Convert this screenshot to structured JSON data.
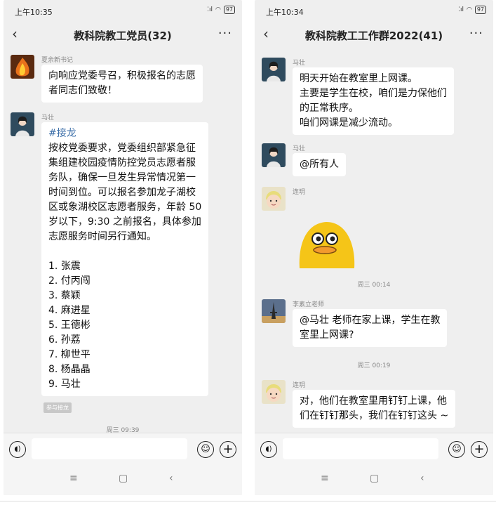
{
  "left": {
    "status": {
      "time": "上午10:35",
      "signal": "⁚ıl",
      "battery": "97"
    },
    "header": {
      "back": "‹",
      "title": "教科院教工党员(32)",
      "more": "···"
    },
    "messages": [
      {
        "sender": "夏余新书记",
        "lines": [
          "向响应党委号召，积极报名的志愿",
          "者同志们致敬！"
        ]
      },
      {
        "sender": "马壮",
        "hashtag": "#接龙",
        "lines": [
          "按校党委要求，党委组织部紧急征",
          "集组建校园疫情防控党员志愿者服",
          "务队，确保一旦发生异常情况第一",
          "时间到位。可以报名参加龙子湖校",
          "区或象湖校区志愿者服务，年龄 50",
          "岁以下，9:30 之前报名，具体参加",
          "志愿服务时间另行通知。",
          "",
          "1. 张震",
          "2. 付丙闯",
          "3. 蔡颖",
          "4. 麻进星",
          "5. 王德彬",
          "6. 孙荔",
          "7. 柳世平",
          "8. 杨晶晶",
          "9. 马壮"
        ]
      }
    ],
    "tag": "参与接龙",
    "timestamp": "周三 09:39"
  },
  "right": {
    "status": {
      "time": "上午10:34",
      "signal": "⁚ıl",
      "battery": "97"
    },
    "header": {
      "back": "‹",
      "title": "教科院教工工作群2022(41)",
      "more": "···"
    },
    "messages": [
      {
        "sender": "马壮",
        "lines": [
          "明天开始在教室里上网课。",
          "主要是学生在校，咱们是力保他们",
          "的正常秩序。",
          "咱们网课是减少流动。"
        ]
      },
      {
        "sender": "马壮",
        "lines": [
          "@所有人"
        ]
      },
      {
        "sender": "连玥",
        "sticker": "duck-sticker"
      },
      {
        "sender": "李素立老师",
        "lines": [
          "@马壮  老师在家上课，学生在教",
          "室里上网课?"
        ]
      },
      {
        "sender": "连玥",
        "lines": [
          "对，他们在教室里用钉钉上课，他",
          "们在钉钉那头，我们在钉钉这头 ~"
        ]
      }
    ],
    "timestamps": [
      "周三 00:14",
      "周三 00:19"
    ]
  },
  "input": {
    "voice_icon": "voice-icon",
    "emoji_icon": "emoji-icon",
    "plus_icon": "plus-icon"
  },
  "nav": {
    "menu": "≡",
    "home": "▢",
    "back": "‹"
  },
  "colors": {
    "background": "#efefef",
    "bubble": "#ffffff",
    "hashtag": "#3b6ea8",
    "sticker": "#f5c518"
  }
}
